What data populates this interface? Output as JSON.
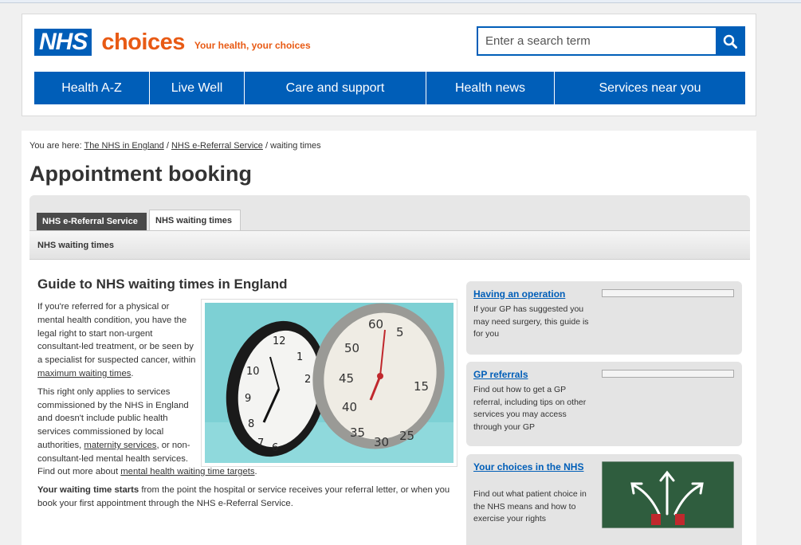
{
  "header": {
    "logo_nhs": "NHS",
    "logo_choices": "choices",
    "tagline": "Your health, your choices",
    "search_placeholder": "Enter a search term",
    "nav": [
      "Health A-Z",
      "Live Well",
      "Care and support",
      "Health news",
      "Services near you"
    ]
  },
  "breadcrumb": {
    "prefix": "You are here:",
    "links": [
      "The NHS in England",
      "NHS e-Referral Service"
    ],
    "current": "waiting times",
    "separator": "/"
  },
  "page_title": "Appointment booking",
  "tabs": {
    "items": [
      "NHS e-Referral Service",
      "NHS waiting times"
    ],
    "active": "NHS waiting times",
    "subheading": "NHS waiting times"
  },
  "article": {
    "title": "Guide to NHS waiting times in England",
    "p1_before": "If you're referred for a physical or mental health condition, you have the legal right to start non-urgent consultant-led treatment, or be seen by a specialist for suspected cancer, within ",
    "p1_link": "maximum waiting times",
    "p1_after": ".",
    "p2_before": "This right only applies to services commissioned by the NHS in England and doesn't include public health services commissioned by local authorities, ",
    "p2_link": "maternity services",
    "p2_after": ", or non-consultant-led mental health services.",
    "p3_before": "Find out more about ",
    "p3_link": "mental health waiting time targets",
    "p3_after": ".",
    "p4_bold": "Your waiting time starts",
    "p4_rest": " from the point the hospital or service receives your referral letter, or when you book your first appointment through the NHS e-Referral Service."
  },
  "sidebar": [
    {
      "title": "Having an operation",
      "desc": "If your GP has suggested you may need surgery, this guide is for you"
    },
    {
      "title": "GP referrals",
      "desc": "Find out how to get a GP referral, including tips on other services you may access through your GP"
    },
    {
      "title": "Your choices in the NHS",
      "desc": "Find out what patient choice in the NHS means and how to exercise your rights"
    }
  ],
  "colors": {
    "nhs_blue": "#005eb8",
    "choices_orange": "#e85a14"
  },
  "icons": [
    "search-icon"
  ]
}
